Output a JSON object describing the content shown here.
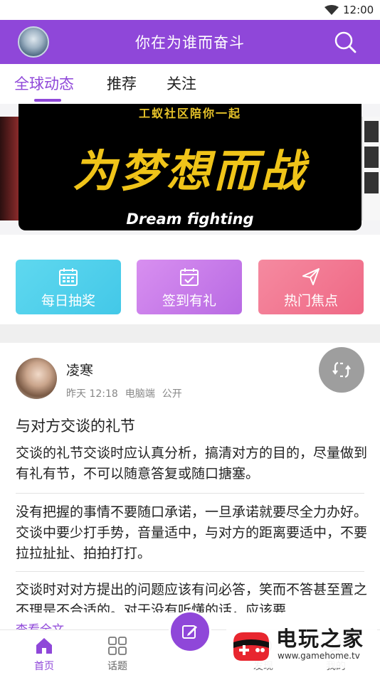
{
  "status_bar": {
    "time": "12:00"
  },
  "header": {
    "title": "你在为谁而奋斗"
  },
  "tabs": [
    {
      "label": "全球动态",
      "active": true
    },
    {
      "label": "推荐",
      "active": false
    },
    {
      "label": "关注",
      "active": false
    }
  ],
  "banner": {
    "top_text": "工蚁社区陪你一起",
    "main_text": "为梦想而战",
    "en_text": "Dream fighting"
  },
  "quick_actions": [
    {
      "label": "每日抽奖",
      "icon": "calendar-icon"
    },
    {
      "label": "签到有礼",
      "icon": "calendar-check-icon"
    },
    {
      "label": "热门焦点",
      "icon": "send-icon"
    }
  ],
  "post": {
    "author": "凌寒",
    "time": "昨天 12:18",
    "device": "电脑端",
    "visibility": "公开",
    "title": "与对方交谈的礼节",
    "paragraphs": [
      "交谈的礼节交谈时应认真分析，搞清对方的目的，尽量做到有礼有节，不可以随意答复或随口搪塞。",
      "没有把握的事情不要随口承诺，一旦承诺就要尽全力办好。交谈中要少打手势，音量适中，与对方的距离要适中，不要拉拉扯扯、拍拍打打。",
      "交谈时对对方提出的问题应该有问必答，笑而不答甚至置之不理是不合适的。对于没有听懂的话，应该要"
    ],
    "read_more": "查看全文"
  },
  "bottom_nav": [
    {
      "label": "首页",
      "icon": "home-icon",
      "active": true
    },
    {
      "label": "话题",
      "icon": "grid-icon",
      "active": false
    },
    {
      "label": "发现",
      "icon": "discover-icon",
      "active": false
    },
    {
      "label": "我的",
      "icon": "user-icon",
      "active": false
    }
  ],
  "watermark": {
    "name": "电玩之家",
    "url": "www.gamehome.tv"
  },
  "colors": {
    "primary": "#8f47d9",
    "quick1": "#4fd0ec",
    "quick2": "#c77ce8",
    "quick3": "#f27892"
  }
}
